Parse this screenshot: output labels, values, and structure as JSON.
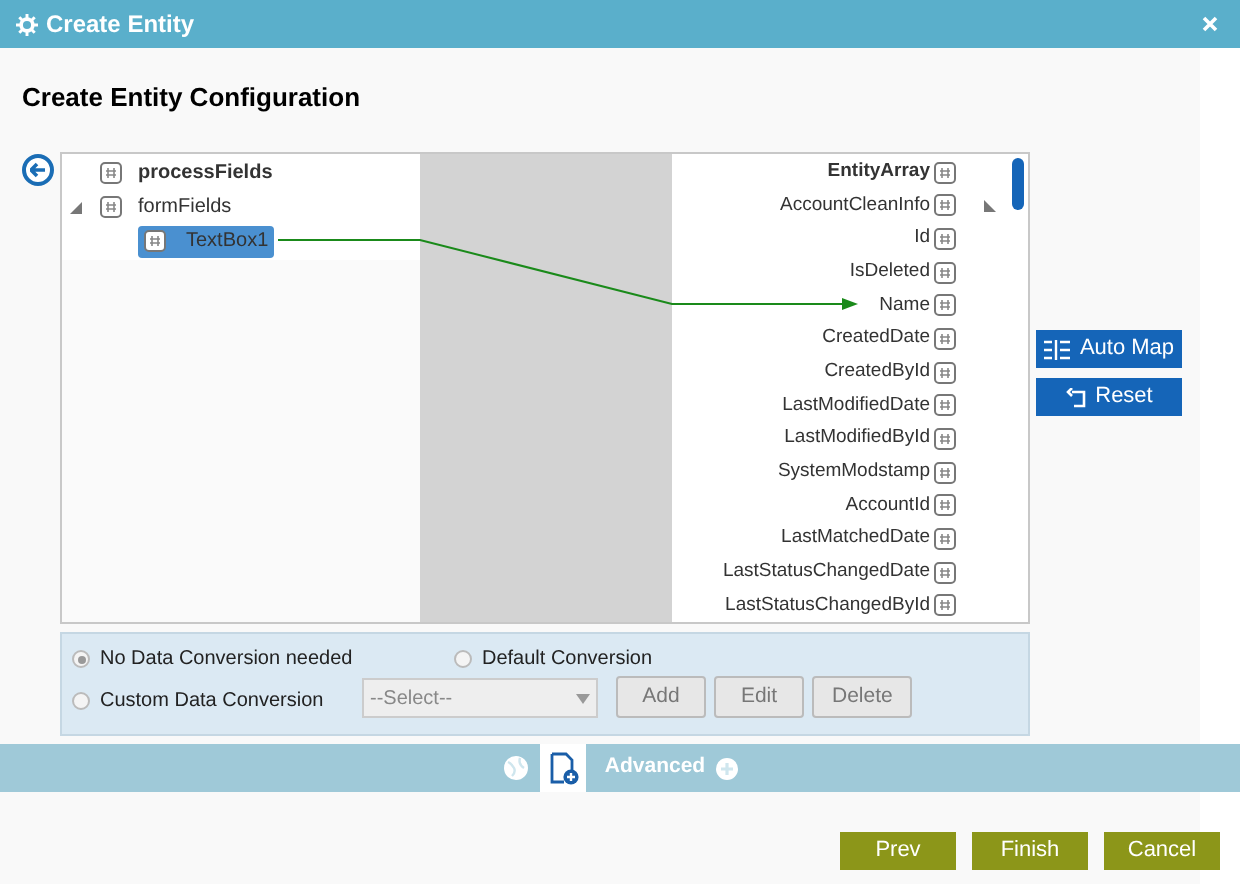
{
  "window": {
    "title": "Create Entity"
  },
  "heading": "Create Entity Configuration",
  "source_tree": [
    {
      "label": "processFields",
      "expanded": false,
      "selected": false
    },
    {
      "label": "formFields",
      "expanded": true,
      "selected": false,
      "children": [
        {
          "label": "TextBox1",
          "selected": true
        }
      ]
    }
  ],
  "target_tree": {
    "label": "EntityArray",
    "children": [
      {
        "label": "AccountCleanInfo",
        "expanded": true,
        "children": [
          {
            "label": "Id"
          },
          {
            "label": "IsDeleted"
          },
          {
            "label": "Name"
          },
          {
            "label": "CreatedDate"
          },
          {
            "label": "CreatedById"
          },
          {
            "label": "LastModifiedDate"
          },
          {
            "label": "LastModifiedById"
          },
          {
            "label": "SystemModstamp"
          },
          {
            "label": "AccountId"
          },
          {
            "label": "LastMatchedDate"
          },
          {
            "label": "LastStatusChangedDate"
          },
          {
            "label": "LastStatusChangedById"
          }
        ]
      }
    ]
  },
  "side_buttons": [
    "Auto Map",
    "Reset"
  ],
  "conversion_options": [
    {
      "label": "No Data Conversion needed",
      "selected": true
    },
    {
      "label": "Default Conversion",
      "selected": false
    },
    {
      "label": "Custom Data Conversion",
      "selected": false
    }
  ],
  "conversion_select": {
    "placeholder": "--Select--"
  },
  "conversion_buttons": [
    "Add",
    "Edit",
    "Delete"
  ],
  "advanced": {
    "label": "Advanced"
  },
  "footer_buttons": [
    "Prev",
    "Finish",
    "Cancel"
  ]
}
